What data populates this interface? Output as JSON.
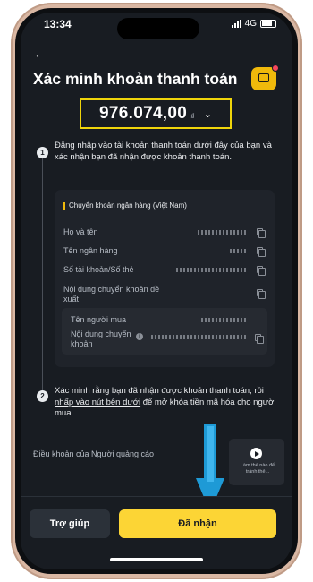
{
  "status_bar": {
    "time": "13:34",
    "network": "4G"
  },
  "header": {
    "title": "Xác minh khoản thanh toán"
  },
  "amount": {
    "value": "976.074,00",
    "currency": "₫"
  },
  "steps": [
    {
      "number": "1",
      "text": "Đăng nhập vào tài khoản thanh toán dưới đây của bạn và xác nhận bạn đã nhận được khoản thanh toán."
    },
    {
      "number": "2",
      "text_before": "Xác minh rằng bạn đã nhận được khoản thanh toán, rồi ",
      "text_link": "nhấp vào nút bên dưới",
      "text_after": " để mở khóa tiền mã hóa cho người mua."
    }
  ],
  "payment_card": {
    "method": "Chuyển khoản ngân hàng (Việt Nam)",
    "fields": [
      {
        "label": "Họ và tên"
      },
      {
        "label": "Tên ngân hàng"
      },
      {
        "label": "Số tài khoản/Số thẻ"
      },
      {
        "label": "Nội dung chuyển khoản đề xuất"
      }
    ],
    "buyer_fields": [
      {
        "label": "Tên người mua"
      },
      {
        "label": "Nội dung chuyển khoản"
      }
    ]
  },
  "terms_label": "Điều khoản của Người quảng cáo",
  "video": {
    "caption": "Làm thế nào để tránh thẻ..."
  },
  "buttons": {
    "help": "Trợ giúp",
    "confirm": "Đã nhận"
  },
  "colors": {
    "accent": "#fcd535",
    "highlight_box": "#f0d50b",
    "arrow": "#1e9ad6",
    "background": "#181c22"
  }
}
